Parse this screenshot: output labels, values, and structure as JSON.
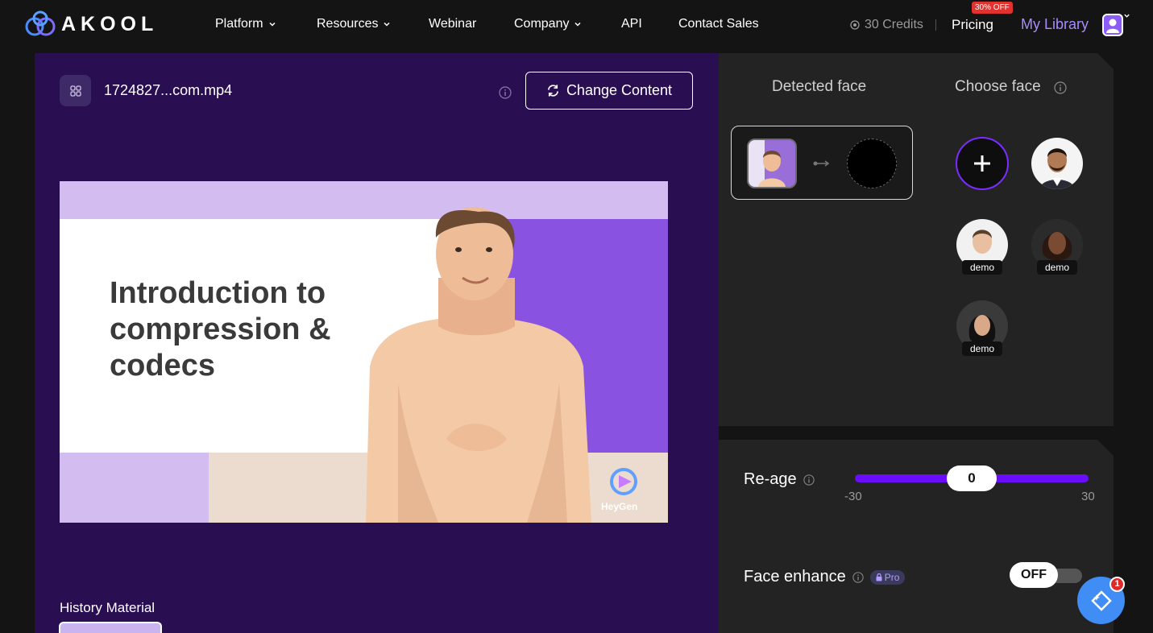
{
  "nav": {
    "brand": "AKOOL",
    "items": [
      {
        "label": "Platform",
        "dropdown": true
      },
      {
        "label": "Resources",
        "dropdown": true
      },
      {
        "label": "Webinar",
        "dropdown": false
      },
      {
        "label": "Company",
        "dropdown": true
      },
      {
        "label": "API",
        "dropdown": false
      },
      {
        "label": "Contact Sales",
        "dropdown": false
      }
    ],
    "credits": "30 Credits",
    "pricing": "Pricing",
    "discount_badge": "30% OFF",
    "my_library": "My Library"
  },
  "editor": {
    "file_name": "1724827...com.mp4",
    "change_content": "Change Content",
    "video_slide": {
      "title_line1": "Introduction to",
      "title_line2": "compression &",
      "title_line3": "codecs",
      "watermark": "HeyGen"
    },
    "history_label": "History Material"
  },
  "faces": {
    "detected_title": "Detected face",
    "choose_title": "Choose face",
    "demo_label": "demo"
  },
  "controls": {
    "reage_label": "Re-age",
    "reage_value": "0",
    "reage_min": "-30",
    "reage_max": "30",
    "enhance_label": "Face enhance",
    "pro_label": "Pro",
    "enhance_state": "OFF"
  },
  "fab": {
    "badge": "1"
  },
  "colors": {
    "accent": "#6a0dfc",
    "panel_left": "#2a0e52",
    "panel_right": "#232323",
    "link": "#a98bff"
  }
}
